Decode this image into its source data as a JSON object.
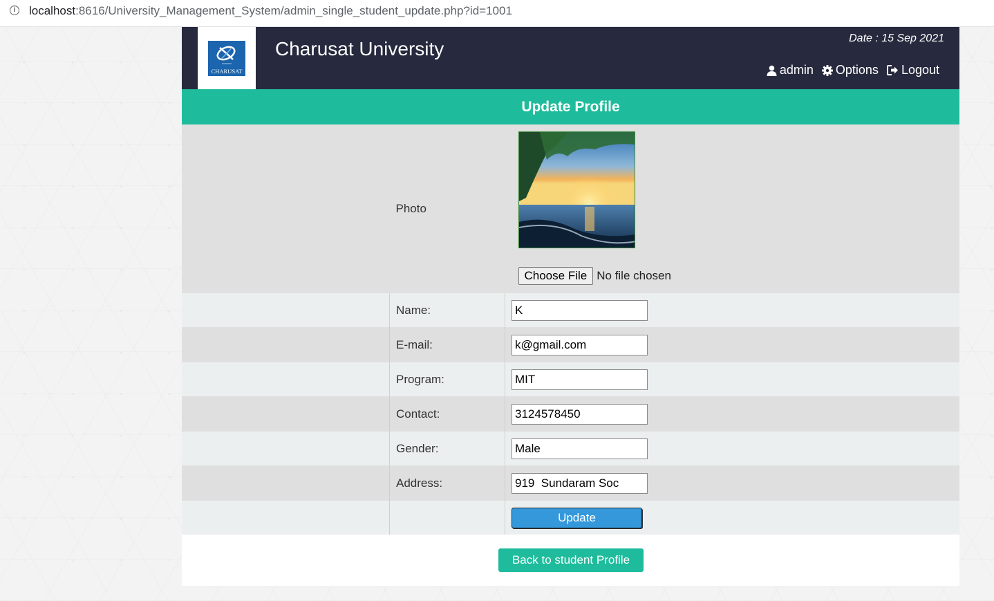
{
  "browser": {
    "url_host": "localhost",
    "url_rest": ":8616/University_Management_System/admin_single_student_update.php?id=1001"
  },
  "header": {
    "logo_text": "CHARUSAT",
    "title": "Charusat University",
    "date": "Date : 15 Sep 2021",
    "nav": {
      "admin": "admin",
      "options": "Options",
      "logout": "Logout"
    }
  },
  "page": {
    "title": "Update Profile"
  },
  "form": {
    "photo_label": "Photo",
    "choose_file": "Choose File",
    "file_status": "No file chosen",
    "fields": {
      "name": {
        "label": "Name:",
        "value": "K"
      },
      "email": {
        "label": "E-mail:",
        "value": "k@gmail.com"
      },
      "program": {
        "label": "Program:",
        "value": "MIT"
      },
      "contact": {
        "label": "Contact:",
        "value": "3124578450"
      },
      "gender": {
        "label": "Gender:",
        "value": "Male"
      },
      "address": {
        "label": "Address:",
        "value": "919  Sundaram Soc"
      }
    },
    "update_button": "Update"
  },
  "back_button": "Back to student Profile",
  "colors": {
    "header_bg": "#272a3e",
    "accent": "#1ebc9c",
    "update_button": "#3498db"
  }
}
